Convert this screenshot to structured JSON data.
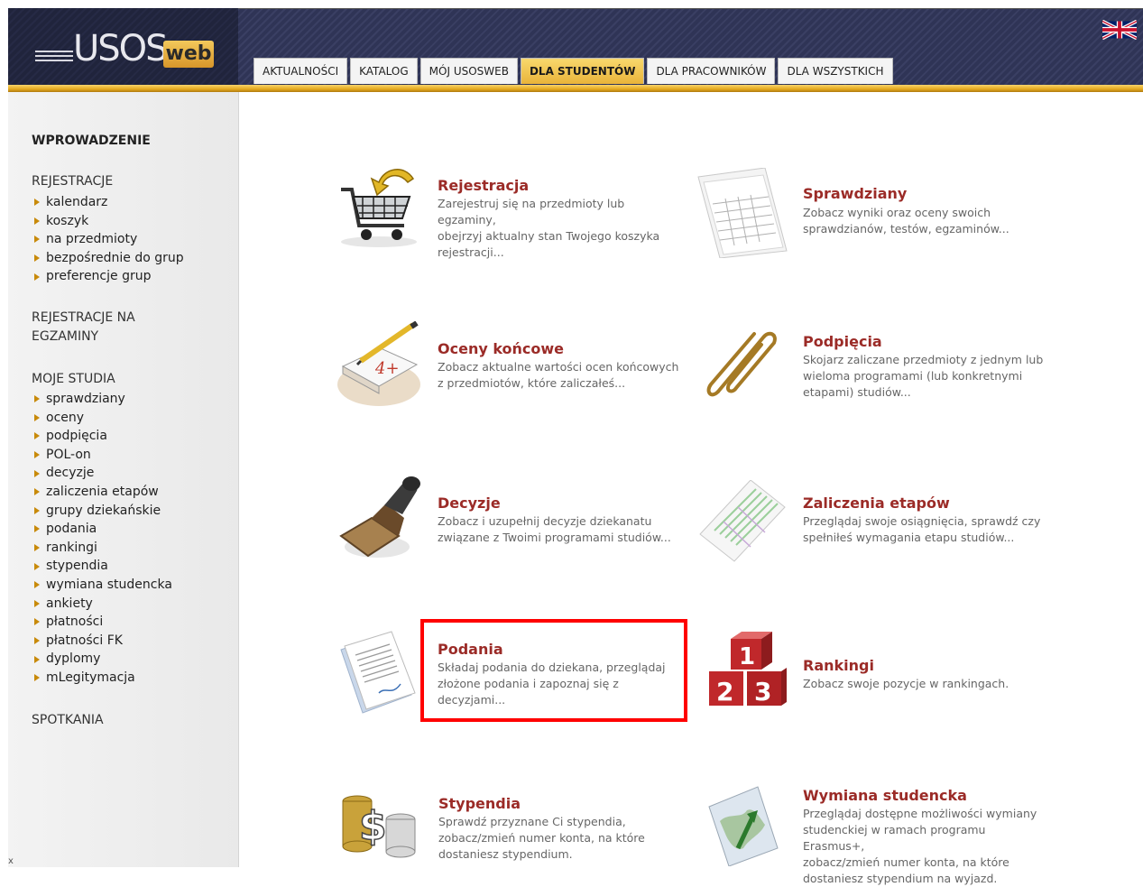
{
  "header": {
    "logo_text": "USOS",
    "logo_badge": "web",
    "language_flag": "uk-flag-icon",
    "tabs": [
      {
        "label": "AKTUALNOŚCI",
        "active": false
      },
      {
        "label": "KATALOG",
        "active": false
      },
      {
        "label": "MÓJ USOSWEB",
        "active": false
      },
      {
        "label": "DLA STUDENTÓW",
        "active": true
      },
      {
        "label": "DLA PRACOWNIKÓW",
        "active": false
      },
      {
        "label": "DLA WSZYSTKICH",
        "active": false
      }
    ]
  },
  "sidebar": {
    "intro": "WPROWADZENIE",
    "rejestracje_heading": "REJESTRACJE",
    "rejestracje_items": [
      "kalendarz",
      "koszyk",
      "na przedmioty",
      "bezpośrednie do grup",
      "preferencje grup"
    ],
    "egzaminy_heading_line1": "REJESTRACJE NA",
    "egzaminy_heading_line2": "EGZAMINY",
    "studia_heading": "MOJE STUDIA",
    "studia_items": [
      "sprawdziany",
      "oceny",
      "podpięcia",
      "POL-on",
      "decyzje",
      "zaliczenia etapów",
      "grupy dziekańskie",
      "podania",
      "rankingi",
      "stypendia",
      "wymiana studencka",
      "ankiety",
      "płatności",
      "płatności FK",
      "dyplomy",
      "mLegitymacja"
    ],
    "spotkania_heading": "SPOTKANIA",
    "corner_mark": "x"
  },
  "tiles": {
    "rejestracja": {
      "title": "Rejestracja",
      "desc1": "Zarejestruj się na przedmioty lub egzaminy,",
      "desc2": "obejrzyj aktualny stan Twojego koszyka",
      "desc3": "rejestracji..."
    },
    "sprawdziany": {
      "title": "Sprawdziany",
      "desc1": "Zobacz wyniki oraz oceny swoich",
      "desc2": "sprawdzianów, testów, egzaminów..."
    },
    "oceny": {
      "title": "Oceny końcowe",
      "desc1": "Zobacz aktualne wartości ocen końcowych",
      "desc2": "z przedmiotów, które zaliczałeś...",
      "badge": "4+"
    },
    "podpiecia": {
      "title": "Podpięcia",
      "desc1": "Skojarz zaliczane przedmioty z jednym lub",
      "desc2": "wieloma programami (lub konkretnymi",
      "desc3": "etapami) studiów..."
    },
    "decyzje": {
      "title": "Decyzje",
      "desc1": "Zobacz i uzupełnij decyzje dziekanatu",
      "desc2": "związane z Twoimi programami studiów..."
    },
    "zaliczenia": {
      "title": "Zaliczenia etapów",
      "desc1": "Przeglądaj swoje osiągnięcia, sprawdź czy",
      "desc2": "spełniłeś wymagania etapu studiów..."
    },
    "podania": {
      "title": "Podania",
      "desc1": "Składaj podania do dziekana, przeglądaj",
      "desc2": "złożone podania i zapoznaj się z",
      "desc3": "decyzjami..."
    },
    "rankingi": {
      "title": "Rankingi",
      "desc1": "Zobacz swoje pozycje w rankingach.",
      "digits": [
        "1",
        "2",
        "3"
      ]
    },
    "stypendia": {
      "title": "Stypendia",
      "desc1": "Sprawdź przyznane Ci stypendia,",
      "desc2": "zobacz/zmień numer konta, na które",
      "desc3": "dostaniesz stypendium."
    },
    "wymiana": {
      "title": "Wymiana studencka",
      "desc1": "Przeglądaj dostępne możliwości wymiany",
      "desc2": "studenckiej w ramach programu Erasmus+,",
      "desc3": "zobacz/zmień numer konta, na które",
      "desc4": "dostaniesz stypendium na wyjazd."
    }
  },
  "colors": {
    "title_red": "#9b2b27",
    "highlight": "#ff0000",
    "tab_active": "#e9b43a"
  }
}
